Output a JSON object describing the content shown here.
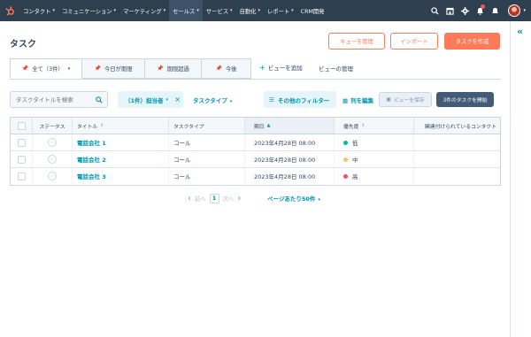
{
  "topnav": {
    "logo_icon": "hubspot-sprocket-icon",
    "items": [
      {
        "label": "コンタクト",
        "caret": true
      },
      {
        "label": "コミュニケーション",
        "caret": true
      },
      {
        "label": "マーケティング",
        "caret": true
      },
      {
        "label": "セールス",
        "caret": true
      },
      {
        "label": "サービス",
        "caret": true
      },
      {
        "label": "自動化",
        "caret": true
      },
      {
        "label": "レポート",
        "caret": true
      },
      {
        "label": "CRM開発",
        "caret": false
      }
    ],
    "active_item": "セールス",
    "icons": [
      "search-icon",
      "marketplace-icon",
      "settings-gear-icon",
      "notifications-bell-icon",
      "help-icon"
    ]
  },
  "page": {
    "title": "タスク",
    "buttons": {
      "manage_queues": "キューを管理",
      "import": "インポート",
      "create_task": "タスクを作成"
    }
  },
  "tabs": [
    {
      "label": "全て（3件）",
      "pinned": true,
      "dropdown": true,
      "active": true
    },
    {
      "label": "今日が期限",
      "pinned": true
    },
    {
      "label": "期限超過",
      "pinned": true
    },
    {
      "label": "今後",
      "pinned": true
    }
  ],
  "tab_links": {
    "add_view": "ビューを追加",
    "manage_views": "ビューの管理"
  },
  "filters": {
    "search_placeholder": "タスクタイトルを検索",
    "assignee_chip": "（1件）担当者",
    "task_type": "タスクタイプ",
    "more_filters": "その他のフィルター",
    "edit_columns": "列を編集",
    "save_view": "ビューを保存",
    "start_tasks": "3件のタスクを開始"
  },
  "table": {
    "headers": [
      "ステータス",
      "タイトル",
      "タスクタイプ",
      "期日",
      "優先度",
      "関連付けられているコンタクト"
    ],
    "rows": [
      {
        "title": "電話会社 1",
        "type": "コール",
        "due": "2023年4月28日 08:00",
        "priority": "低",
        "priority_color": "#00bda5"
      },
      {
        "title": "電話会社 2",
        "type": "コール",
        "due": "2023年4月28日 08:00",
        "priority": "中",
        "priority_color": "#f5c26b"
      },
      {
        "title": "電話会社 3",
        "type": "コール",
        "due": "2023年4月28日 08:00",
        "priority": "高",
        "priority_color": "#f2545b"
      }
    ]
  },
  "pagination": {
    "prev": "前へ",
    "current": "1",
    "next": "次へ",
    "per_page": "ページあたり50件"
  },
  "colors": {
    "nav_bg": "#2e3f50",
    "accent_orange": "#ff7a59",
    "link_teal": "#0091ae",
    "dark_button": "#425b76"
  }
}
